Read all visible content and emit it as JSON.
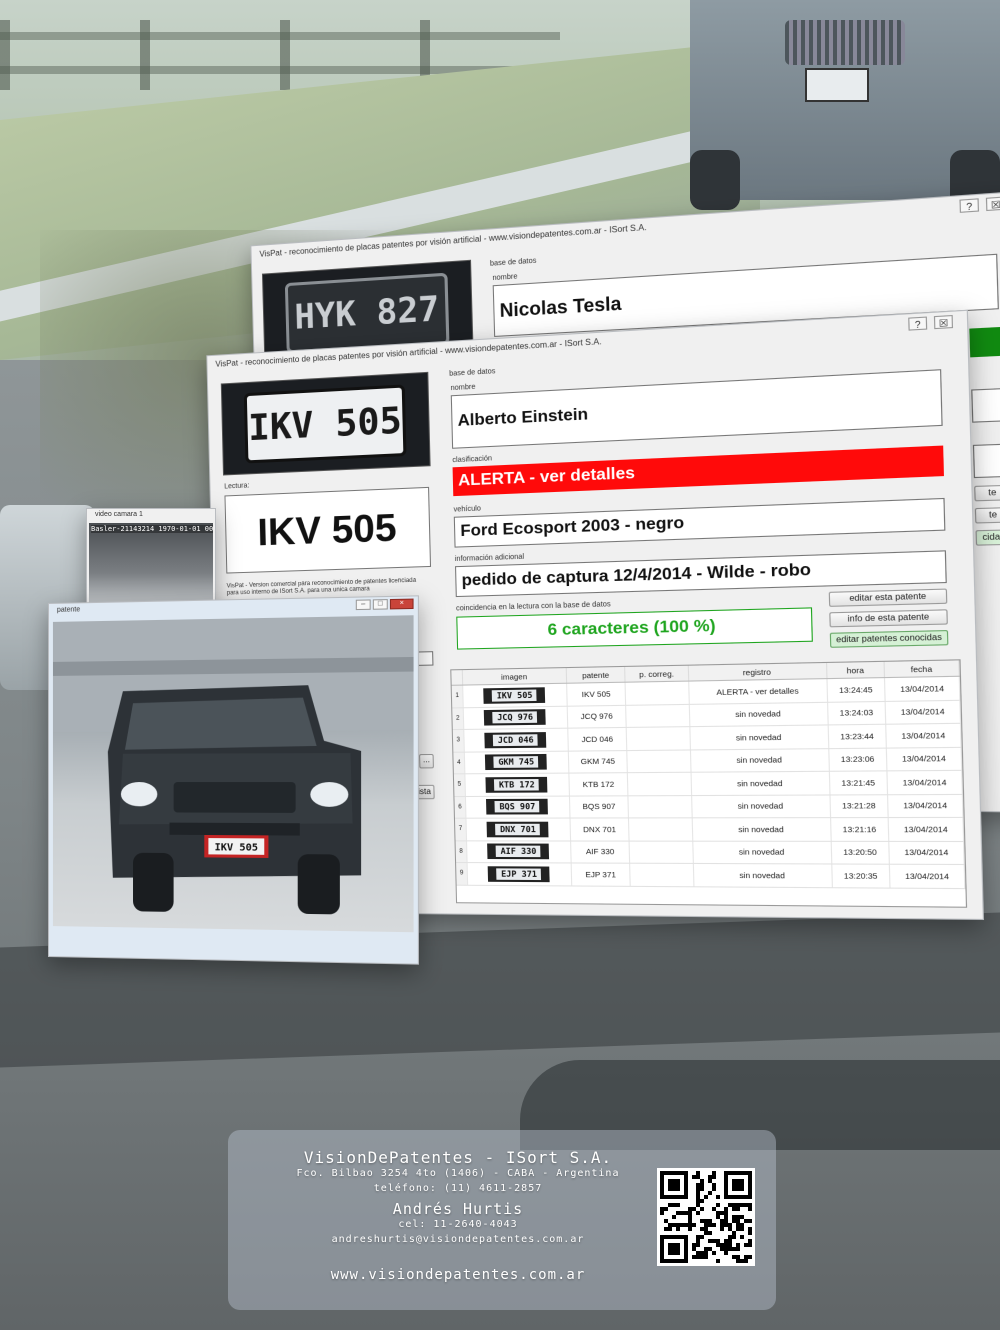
{
  "back_window": {
    "title": "VisPat - reconocimiento de placas patentes por visión artificial - www.visiondepatentes.com.ar - ISort S.A.",
    "plate_image": "HYK 827",
    "db_label": "base de datos",
    "name_label": "nombre",
    "name_value": "Nicolas Tesla",
    "help_btn": "?",
    "close_btn": "☒",
    "btn_frag_1": "te",
    "btn_frag_2": "te",
    "btn_frag_3": "cidas"
  },
  "front_window": {
    "title": "VisPat - reconocimiento de placas patentes por visión artificial - www.visiondepatentes.com.ar - ISort S.A.",
    "help_btn": "?",
    "close_btn": "☒",
    "plate_image": "IKV 505",
    "lectura_label": "Lectura:",
    "lectura_value": "IKV 505",
    "version_note": "VisPat - Version comercial para reconocimiento de patentes licenciada para uso interno de ISort S.A. para una unica camara",
    "db_label": "base de datos",
    "name_label": "nombre",
    "name_value": "Alberto Einstein",
    "class_label": "clasificación",
    "class_value": "ALERTA - ver detalles",
    "vehicle_label": "vehículo",
    "vehicle_value": "Ford Ecosport 2003 - negro",
    "info_label": "información adicional",
    "info_value": "pedido de captura 12/4/2014 - Wilde - robo",
    "match_label": "coincidencia en la lectura con la base de datos",
    "match_value": "6 caracteres (100 %)",
    "btn_edit": "editar esta patente",
    "btn_info": "info de esta patente",
    "btn_known": "editar patentes conocidas",
    "btn_lista": "r lista",
    "btn_dots": "...",
    "table": {
      "headers": [
        "imagen",
        "patente",
        "p. correg.",
        "registro",
        "hora",
        "fecha"
      ],
      "rows": [
        {
          "n": "1",
          "img": "IKV 505",
          "patente": "IKV 505",
          "registro": "ALERTA - ver detalles",
          "hora": "13:24:45",
          "fecha": "13/04/2014"
        },
        {
          "n": "2",
          "img": "JCQ 976",
          "patente": "JCQ 976",
          "registro": "sin novedad",
          "hora": "13:24:03",
          "fecha": "13/04/2014"
        },
        {
          "n": "3",
          "img": "JCD 046",
          "patente": "JCD 046",
          "registro": "sin novedad",
          "hora": "13:23:44",
          "fecha": "13/04/2014"
        },
        {
          "n": "4",
          "img": "GKM 745",
          "patente": "GKM 745",
          "registro": "sin novedad",
          "hora": "13:23:06",
          "fecha": "13/04/2014"
        },
        {
          "n": "5",
          "img": "KTB 172",
          "patente": "KTB 172",
          "registro": "sin novedad",
          "hora": "13:21:45",
          "fecha": "13/04/2014"
        },
        {
          "n": "6",
          "img": "BQS 907",
          "patente": "BQS 907",
          "registro": "sin novedad",
          "hora": "13:21:28",
          "fecha": "13/04/2014"
        },
        {
          "n": "7",
          "img": "DNX 701",
          "patente": "DNX 701",
          "registro": "sin novedad",
          "hora": "13:21:16",
          "fecha": "13/04/2014"
        },
        {
          "n": "8",
          "img": "AIF 330",
          "patente": "AIF 330",
          "registro": "sin novedad",
          "hora": "13:20:50",
          "fecha": "13/04/2014"
        },
        {
          "n": "9",
          "img": "EJP 371",
          "patente": "EJP 371",
          "registro": "sin novedad",
          "hora": "13:20:35",
          "fecha": "13/04/2014"
        }
      ]
    }
  },
  "video_window": {
    "title": "video camara 1",
    "overlay_text": "Basler-21143214 1970-01-01 00:"
  },
  "patente_window": {
    "title": "patente",
    "plate": "IKV 505"
  },
  "footer": {
    "company": "VisionDePatentes - ISort S.A.",
    "address": "Fco. Bilbao 3254 4to (1406) - CABA - Argentina",
    "phone": "teléfono: (11) 4611-2857",
    "contact_name": "Andrés Hurtis",
    "cell": "cel: 11-2640-4043",
    "email": "andreshurtis@visiondepatentes.com.ar",
    "website": "www.visiondepatentes.com.ar"
  },
  "colors": {
    "alert": "#ff0a0a",
    "match_green": "#1fa51f",
    "status_green": "#108a10"
  }
}
